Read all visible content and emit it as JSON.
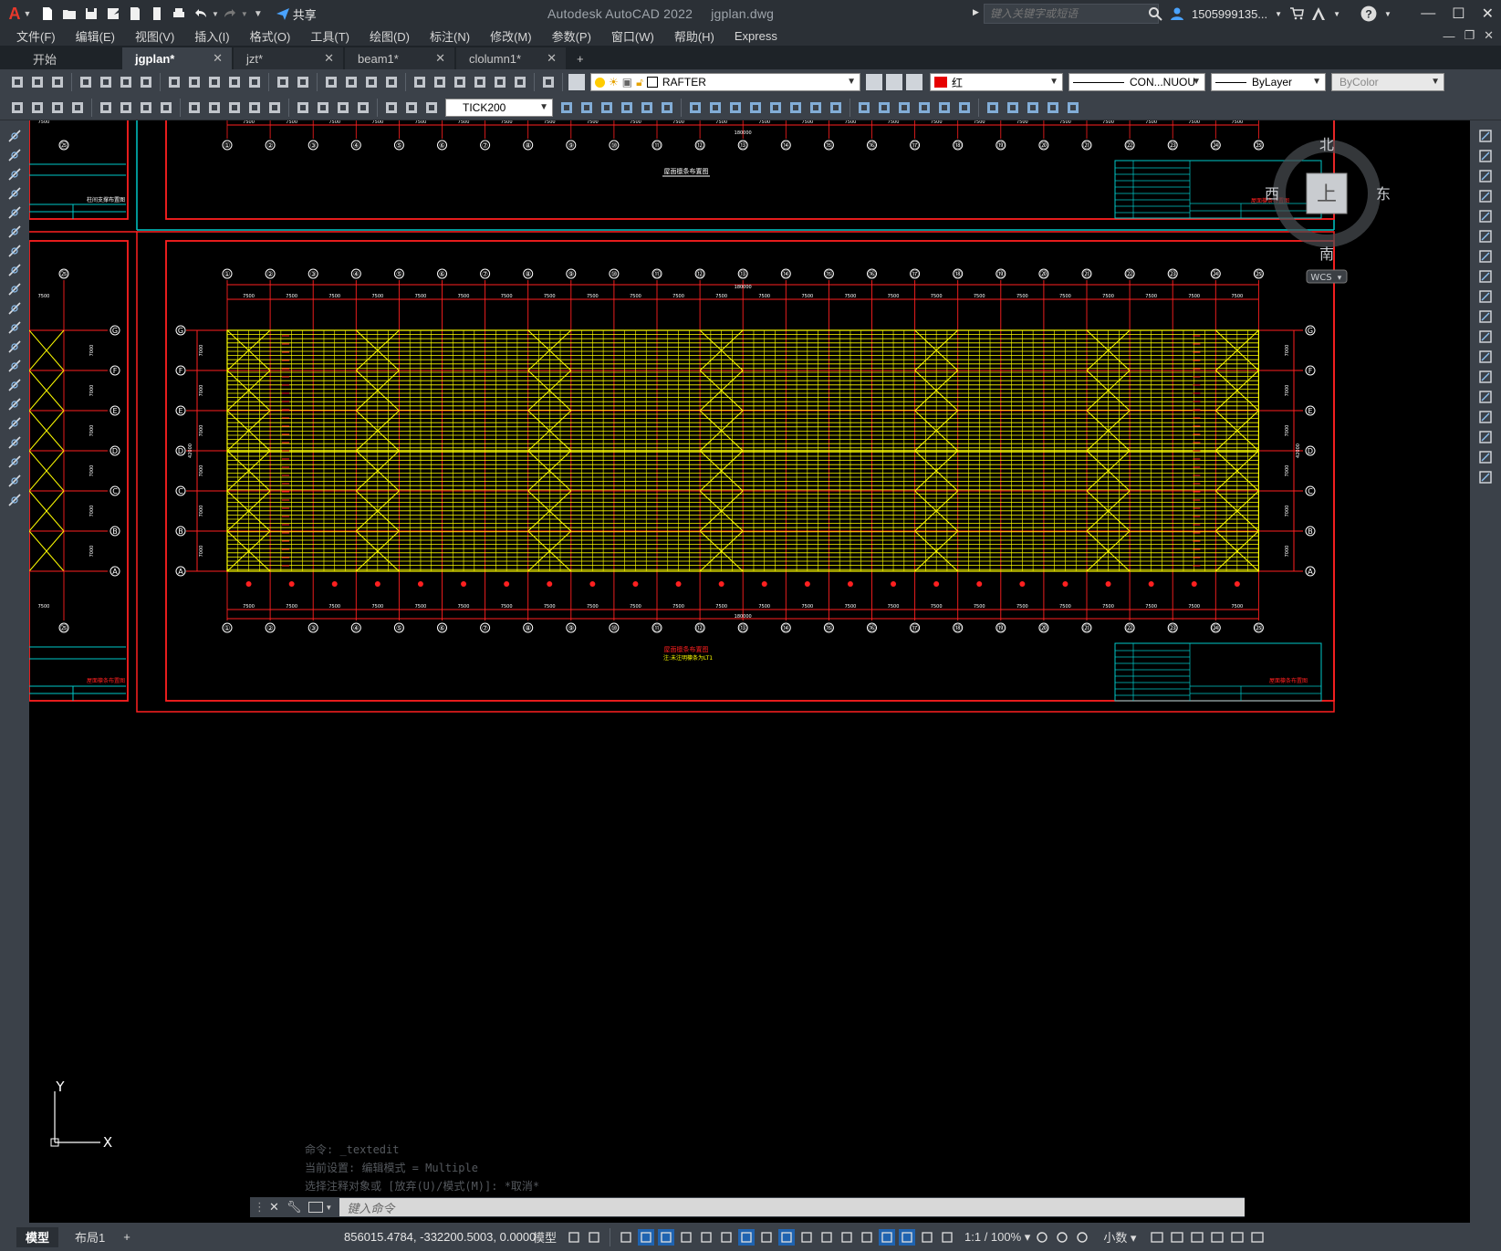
{
  "title": {
    "app": "Autodesk AutoCAD 2022",
    "file": "jgplan.dwg",
    "share": "共享",
    "search_placeholder": "键入关键字或短语",
    "user": "1505999135...",
    "logo": "A"
  },
  "menu": [
    "文件(F)",
    "编辑(E)",
    "视图(V)",
    "插入(I)",
    "格式(O)",
    "工具(T)",
    "绘图(D)",
    "标注(N)",
    "修改(M)",
    "参数(P)",
    "窗口(W)",
    "帮助(H)",
    "Express"
  ],
  "tabs": [
    {
      "label": "开始"
    },
    {
      "label": "jgplan*",
      "close": "✕"
    },
    {
      "label": "jzt*",
      "close": "✕"
    },
    {
      "label": "beam1*",
      "close": "✕"
    },
    {
      "label": "clolumn1*",
      "close": "✕"
    },
    {
      "label": "+"
    }
  ],
  "toolbar": {
    "layer": "RAFTER",
    "color": "红",
    "linetype": "CON...NUOU",
    "lineweight": "ByLayer",
    "plotstyle": "ByColor",
    "dimstyle": "TICK200"
  },
  "compass": {
    "n": "北",
    "s": "南",
    "w": "西",
    "e": "东",
    "center": "上",
    "wcs": "WCS"
  },
  "ucs": {
    "x": "X",
    "y": "Y"
  },
  "drawing": {
    "grid_numbers": [
      "①",
      "②",
      "③",
      "④",
      "⑤",
      "⑥",
      "⑦",
      "⑧",
      "⑨",
      "⑩",
      "⑪",
      "⑫",
      "⑬",
      "⑭",
      "⑮",
      "⑯",
      "⑰",
      "⑱",
      "⑲",
      "⑳",
      "㉑",
      "㉒",
      "㉓",
      "㉔",
      "㉕"
    ],
    "row_labels": [
      "G",
      "F",
      "E",
      "D",
      "C",
      "B",
      "A"
    ],
    "spacing": "7500",
    "total": "180000",
    "bay": "7000",
    "side_label": "42000",
    "top_caption": "屋面檩条布置图",
    "main_caption_1": "屋面檩条布置图",
    "main_caption_2": "注:未注明檩条为LT1",
    "left_caption_top": "柱间支撑布置图",
    "left_caption_bottom": "屋面檩条布置图",
    "tb_caption_top": "屋面檩条布置图",
    "tb_caption_bottom": "屋面檩条布置图"
  },
  "command": {
    "history": [
      "命令: _textedit",
      "当前设置: 编辑模式 = Multiple",
      "选择注释对象或 [放弃(U)/模式(M)]: *取消*"
    ],
    "placeholder": "键入命令"
  },
  "status": {
    "layouts": [
      "模型",
      "布局1",
      "+"
    ],
    "coords": "856015.4784, -332200.5003, 0.0000",
    "model": "模型",
    "scale": "1:1 / 100%",
    "units": "小数"
  }
}
